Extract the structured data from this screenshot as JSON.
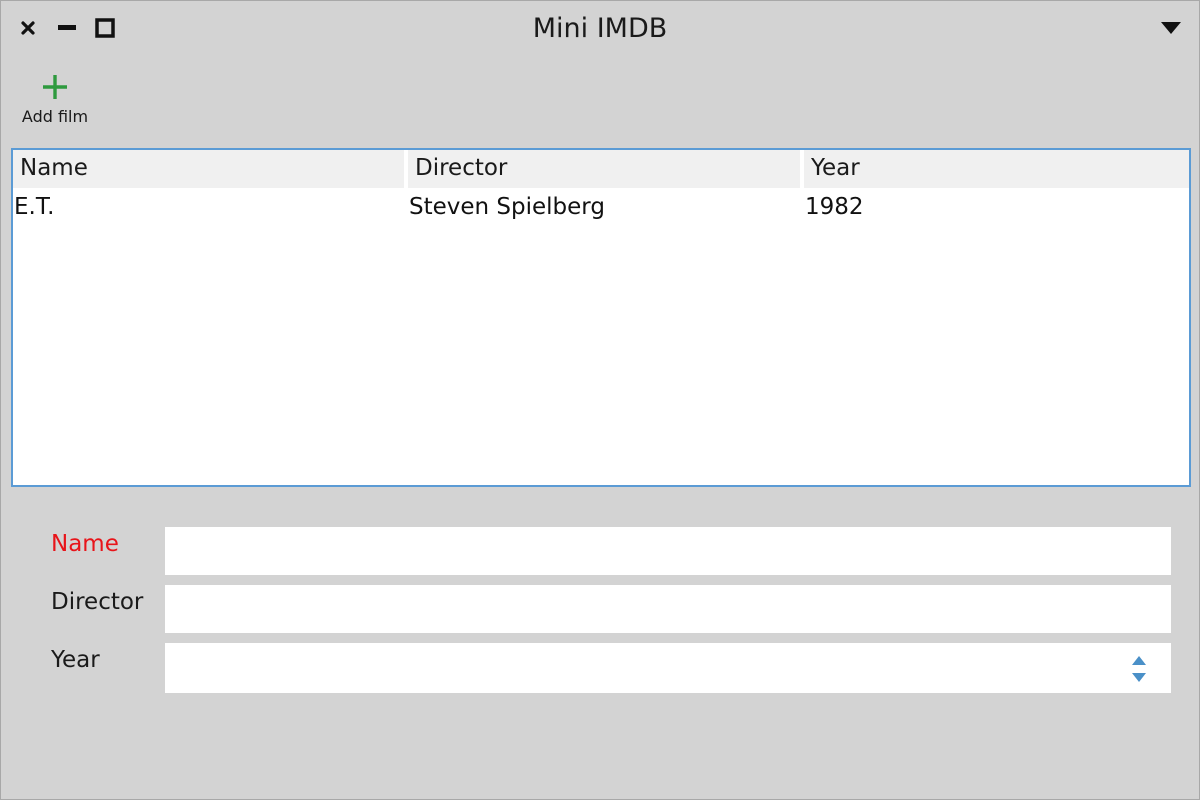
{
  "window": {
    "title": "Mini IMDB",
    "controls": [
      "close-icon",
      "minimize-icon",
      "maximize-icon"
    ],
    "menu_icon": "triangle-down-icon"
  },
  "toolbar": {
    "add_film": {
      "label": "Add film",
      "icon": "plus-icon",
      "icon_color": "#2e9a3e"
    }
  },
  "table": {
    "columns": [
      "Name",
      "Director",
      "Year"
    ],
    "rows": [
      {
        "name": "E.T.",
        "director": "Steven Spielberg",
        "year": "1982"
      }
    ],
    "border_color": "#5b9bd5"
  },
  "form": {
    "name": {
      "label": "Name",
      "value": "",
      "required_color": "#e8141a"
    },
    "director": {
      "label": "Director",
      "value": ""
    },
    "year": {
      "label": "Year",
      "value": "",
      "spinner_color": "#4a90c8"
    }
  }
}
